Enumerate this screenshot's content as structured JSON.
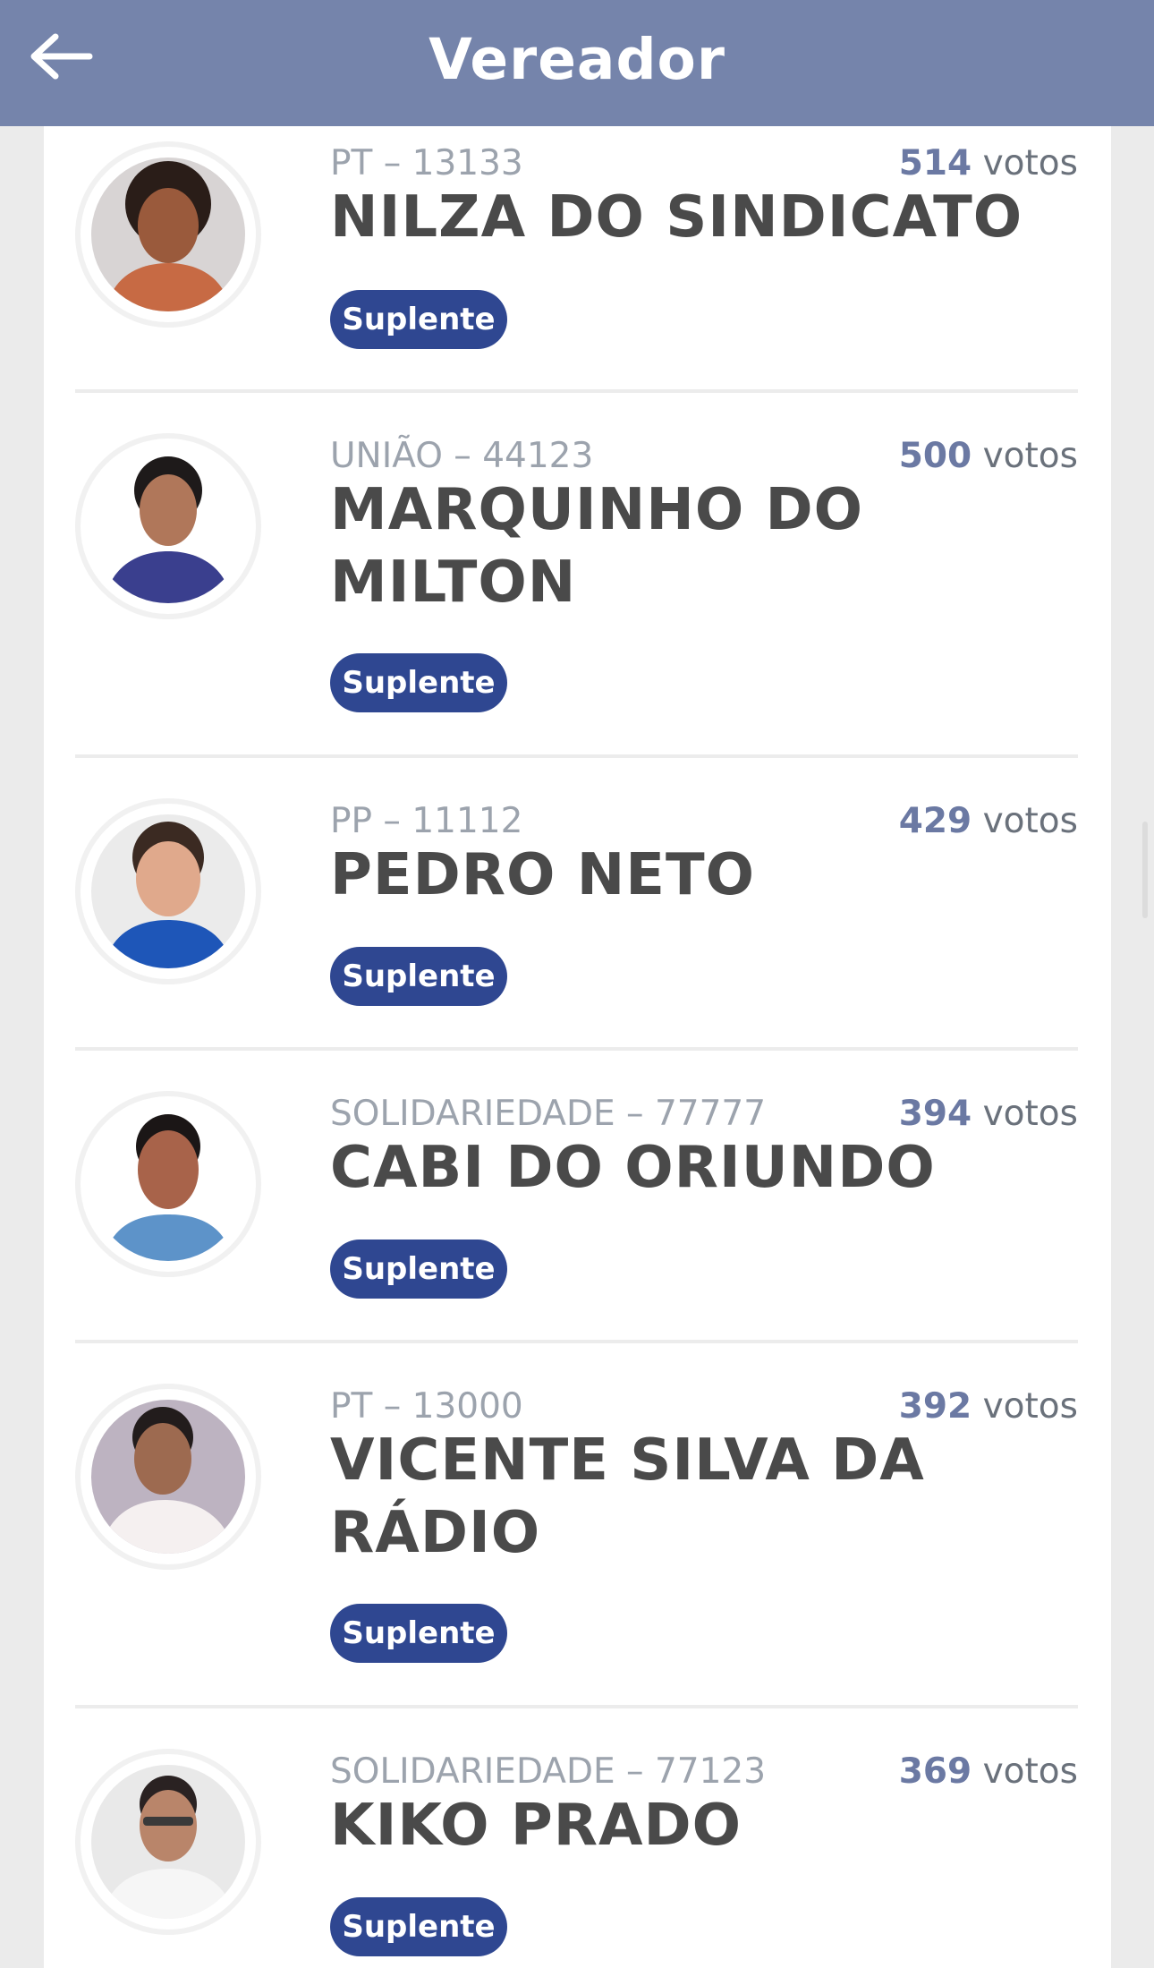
{
  "header": {
    "title": "Vereador",
    "back_icon": "arrow-left-icon"
  },
  "candidates": [
    {
      "party_number": "PT – 13133",
      "votes_number": "514",
      "votes_label": "votos",
      "name": "NILZA DO SINDICATO",
      "status": "Suplente",
      "photo_colors": {
        "bg": "#d8d4d4",
        "skin": "#9a5a3c",
        "hair": "#2a1d18",
        "shirt": "#c76a44"
      }
    },
    {
      "party_number": "UNIÃO – 44123",
      "votes_number": "500",
      "votes_label": "votos",
      "name": "MARQUINHO DO MILTON",
      "status": "Suplente",
      "photo_colors": {
        "bg": "#ffffff",
        "skin": "#b0775a",
        "hair": "#1e1a1a",
        "shirt": "#3a3f8e"
      }
    },
    {
      "party_number": "PP – 11112",
      "votes_number": "429",
      "votes_label": "votos",
      "name": "PEDRO NETO",
      "status": "Suplente",
      "photo_colors": {
        "bg": "#ebebeb",
        "skin": "#e0a98c",
        "hair": "#3b2a22",
        "shirt": "#1e56b8"
      }
    },
    {
      "party_number": "SOLIDARIEDADE – 77777",
      "votes_number": "394",
      "votes_label": "votos",
      "name": "CABI DO ORIUNDO",
      "status": "Suplente",
      "photo_colors": {
        "bg": "#ffffff",
        "skin": "#a8634a",
        "hair": "#1b1616",
        "shirt": "#5d93c9"
      }
    },
    {
      "party_number": "PT – 13000",
      "votes_number": "392",
      "votes_label": "votos",
      "name": "VICENTE SILVA DA RÁDIO",
      "status": "Suplente",
      "photo_colors": {
        "bg": "#bdb3c1",
        "skin": "#9d6a50",
        "hair": "#221c1c",
        "shirt": "#f5f0f0"
      }
    },
    {
      "party_number": "SOLIDARIEDADE – 77123",
      "votes_number": "369",
      "votes_label": "votos",
      "name": "KIKO PRADO",
      "status": "Suplente",
      "photo_colors": {
        "bg": "#e9e9e9",
        "skin": "#b9856a",
        "hair": "#2a2222",
        "shirt": "#f6f6f6"
      }
    }
  ]
}
